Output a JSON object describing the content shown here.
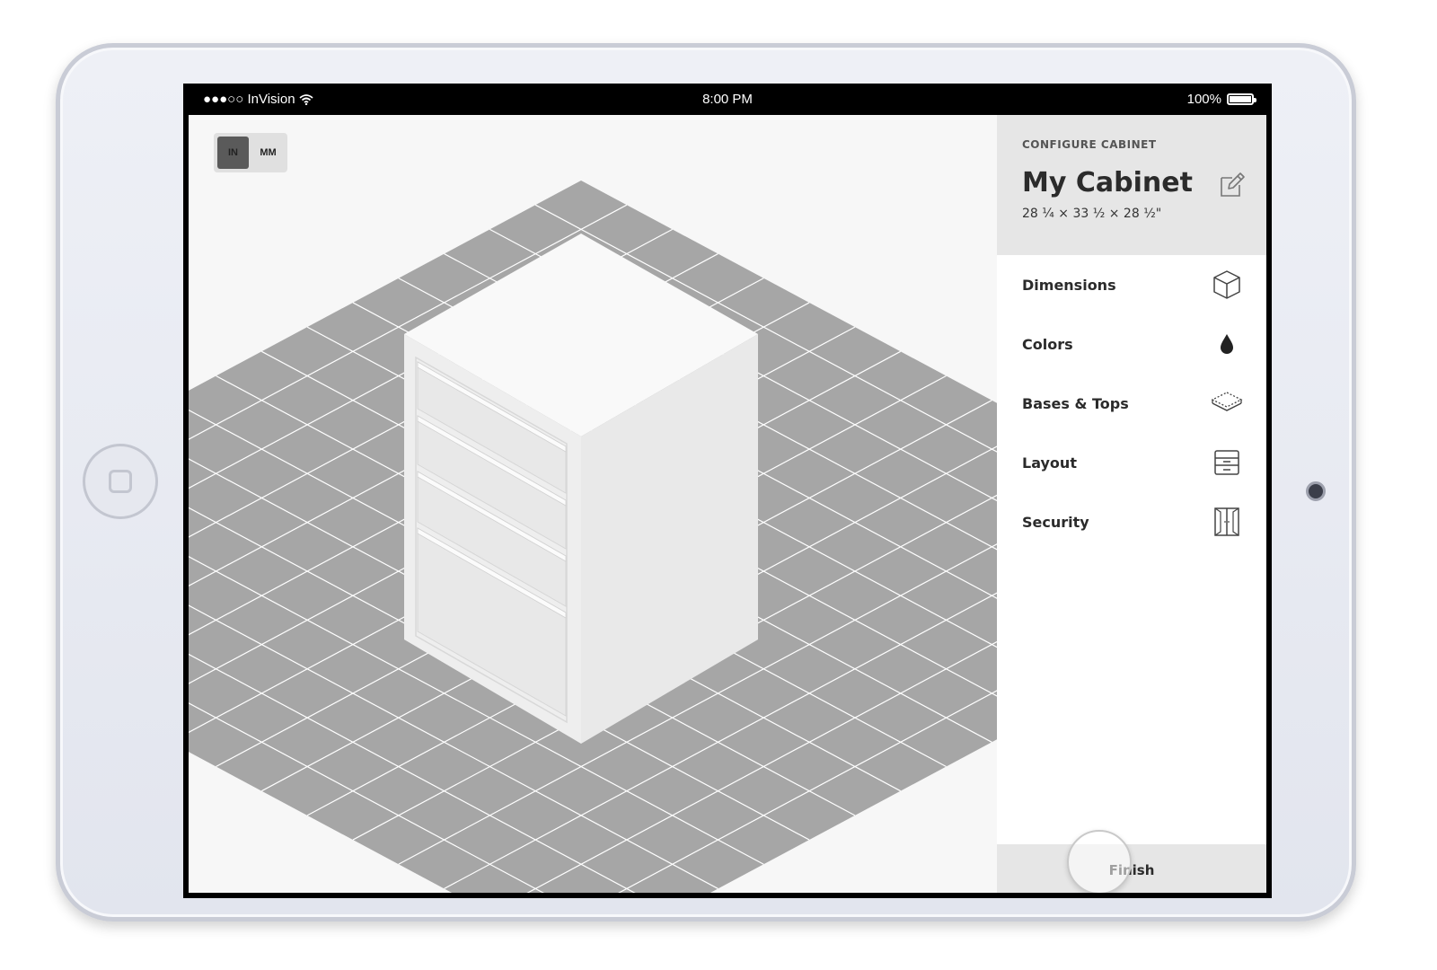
{
  "status_bar": {
    "carrier": "●●●○○ InVision",
    "time": "8:00 PM",
    "battery": "100%",
    "battery_level": 1.0,
    "wifi_icon": "wifi-icon"
  },
  "units": {
    "options": [
      "IN",
      "MM"
    ],
    "selected": "IN"
  },
  "panel": {
    "kicker": "CONFIGURE CABINET",
    "title": "My Cabinet",
    "dimensions": "28 ¼ × 33 ½ × 28 ½\"",
    "edit_icon": "edit-icon",
    "menu": [
      {
        "label": "Dimensions",
        "icon": "cube-icon"
      },
      {
        "label": "Colors",
        "icon": "drop-icon"
      },
      {
        "label": "Bases & Tops",
        "icon": "layers-icon"
      },
      {
        "label": "Layout",
        "icon": "drawer-icon"
      },
      {
        "label": "Security",
        "icon": "door-icon"
      }
    ],
    "finish_label": "Finish"
  },
  "colors": {
    "floor": "#a6a6a6",
    "floor_lines": "#ffffff",
    "cabinet_top": "#f9f9f9",
    "cabinet_left": "#eeeeee",
    "cabinet_right": "#e9e9e9",
    "header_bg": "#e6e6e6"
  }
}
